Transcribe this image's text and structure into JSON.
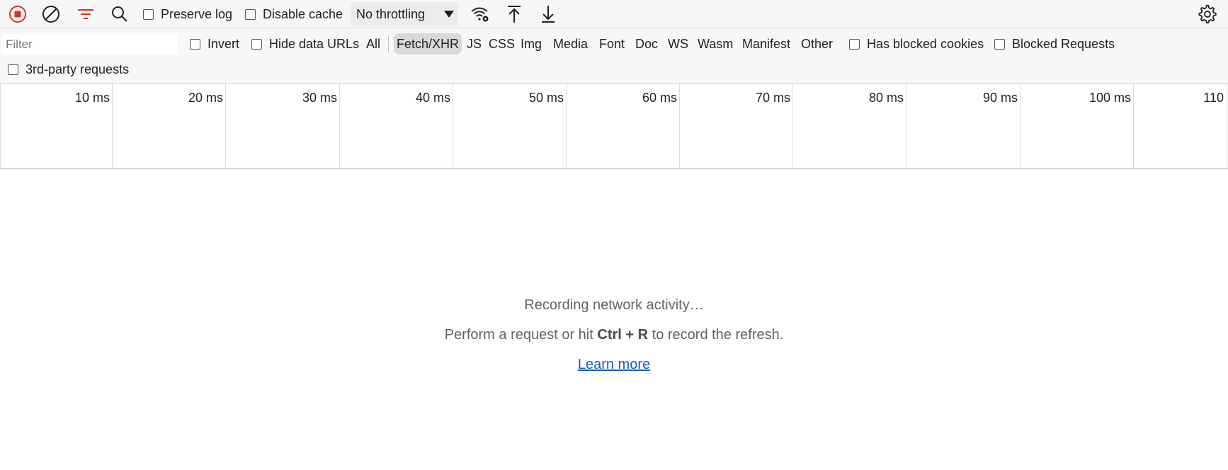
{
  "toolbar": {
    "record_icon": "record-stop-icon",
    "clear_icon": "clear-icon",
    "filter_icon": "filter-icon",
    "search_icon": "search-icon",
    "preserve_log": {
      "label": "Preserve log",
      "checked": false
    },
    "disable_cache": {
      "label": "Disable cache",
      "checked": false
    },
    "throttling": {
      "value": "No throttling"
    },
    "network_conditions_icon": "wifi-settings-icon",
    "import_icon": "upload-icon",
    "export_icon": "download-icon",
    "settings_icon": "gear-icon",
    "colors": {
      "record": "#d93025",
      "filter": "#d93025"
    }
  },
  "filterbar": {
    "filter_placeholder": "Filter",
    "invert": {
      "label": "Invert",
      "checked": false
    },
    "hide_data_urls": {
      "label": "Hide data URLs",
      "checked": false
    },
    "types": [
      {
        "label": "All",
        "selected": false
      },
      {
        "label": "Fetch/XHR",
        "selected": true
      },
      {
        "label": "JS",
        "selected": false
      },
      {
        "label": "CSS",
        "selected": false
      },
      {
        "label": "Img",
        "selected": false
      },
      {
        "label": "Media",
        "selected": false
      },
      {
        "label": "Font",
        "selected": false
      },
      {
        "label": "Doc",
        "selected": false
      },
      {
        "label": "WS",
        "selected": false
      },
      {
        "label": "Wasm",
        "selected": false
      },
      {
        "label": "Manifest",
        "selected": false
      },
      {
        "label": "Other",
        "selected": false
      }
    ],
    "has_blocked_cookies": {
      "label": "Has blocked cookies",
      "checked": false
    },
    "blocked_requests": {
      "label": "Blocked Requests",
      "checked": false
    },
    "third_party": {
      "label": "3rd-party requests",
      "checked": false
    }
  },
  "timeline": {
    "ticks": [
      "10 ms",
      "20 ms",
      "30 ms",
      "40 ms",
      "50 ms",
      "60 ms",
      "70 ms",
      "80 ms",
      "90 ms",
      "100 ms",
      "110"
    ]
  },
  "empty_state": {
    "title": "Recording network activity…",
    "hint_prefix": "Perform a request or hit ",
    "hint_key_1": "Ctrl",
    "hint_plus": " + ",
    "hint_key_2": "R",
    "hint_suffix": " to record the refresh.",
    "learn_more": "Learn more"
  }
}
